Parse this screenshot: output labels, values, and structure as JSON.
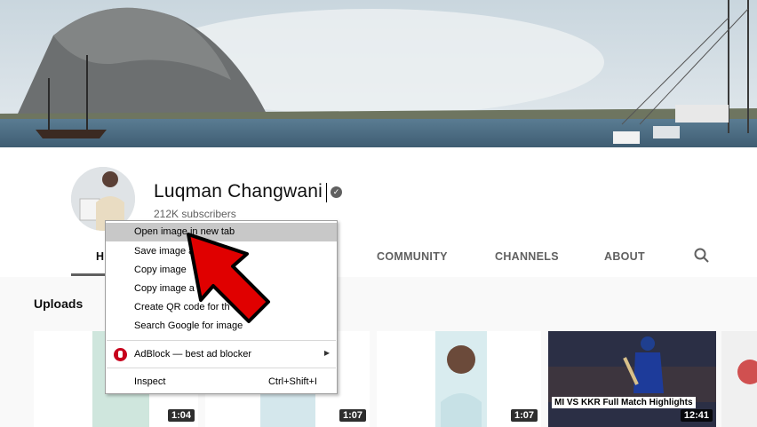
{
  "channel": {
    "name": "Luqman Changwani",
    "subscribers": "212K subscribers"
  },
  "tabs": [
    {
      "label": "H",
      "active": true
    },
    {
      "label": "COMMUNITY",
      "active": false
    },
    {
      "label": "CHANNELS",
      "active": false
    },
    {
      "label": "ABOUT",
      "active": false
    }
  ],
  "uploads": {
    "title": "Uploads",
    "videos": [
      {
        "duration": "1:04"
      },
      {
        "duration": "1:07"
      },
      {
        "duration": "1:07"
      },
      {
        "duration": "12:41",
        "caption": "MI VS KKR Full Match Highlights"
      }
    ]
  },
  "context_menu": {
    "items": [
      {
        "label": "Open image in new tab",
        "highlighted": true
      },
      {
        "label": "Save image a"
      },
      {
        "label": "Copy image"
      },
      {
        "label": "Copy image a"
      },
      {
        "label": "Create QR code for th"
      },
      {
        "label": "Search Google for image"
      },
      {
        "label": "AdBlock — best ad blocker",
        "has_submenu": true
      },
      {
        "label": "Inspect",
        "shortcut": "Ctrl+Shift+I"
      }
    ]
  },
  "colors": {
    "menu_highlight": "#c8c8c8",
    "arrow_red": "#e00000",
    "adblock_red": "#c7001c"
  }
}
